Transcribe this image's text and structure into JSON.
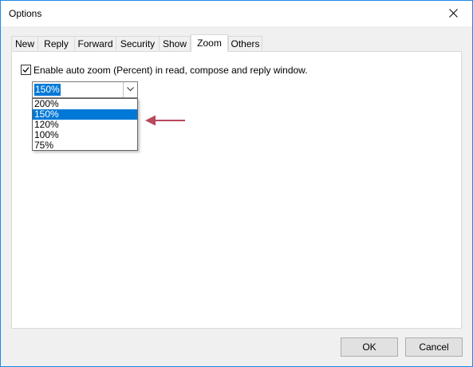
{
  "window": {
    "title": "Options",
    "accent_color": "#1e88e5"
  },
  "tabs": [
    {
      "label": "New"
    },
    {
      "label": "Reply"
    },
    {
      "label": "Forward"
    },
    {
      "label": "Security"
    },
    {
      "label": "Show"
    },
    {
      "label": "Zoom",
      "active": true
    },
    {
      "label": "Others"
    }
  ],
  "zoom": {
    "enable_checked": true,
    "enable_label": "Enable auto zoom (Percent) in read, compose and reply window.",
    "selected_value": "150%",
    "options": [
      "200%",
      "150%",
      "120%",
      "100%",
      "75%"
    ],
    "highlight_color": "#0078d7"
  },
  "annotation": {
    "arrow_color": "#b8485b",
    "icon": "left-arrow-icon"
  },
  "buttons": {
    "ok_label": "OK",
    "cancel_label": "Cancel"
  }
}
